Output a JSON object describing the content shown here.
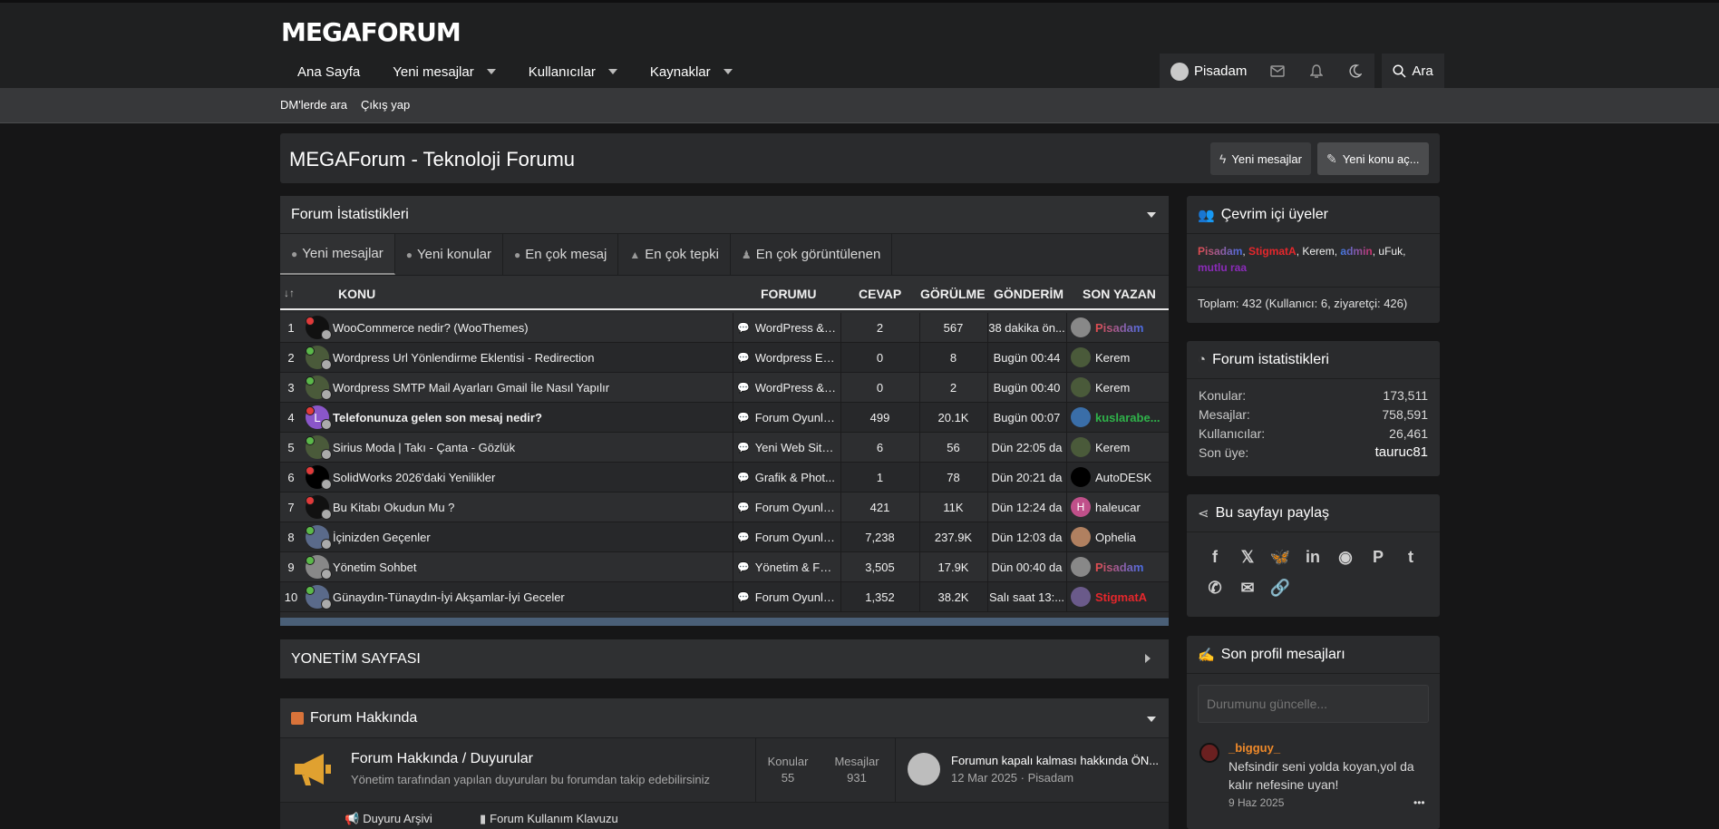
{
  "logo": "MEGAFORUM",
  "nav": [
    {
      "label": "Ana Sayfa",
      "caret": false
    },
    {
      "label": "Yeni mesajlar",
      "caret": true
    },
    {
      "label": "Kullanıcılar",
      "caret": true
    },
    {
      "label": "Kaynaklar",
      "caret": true
    }
  ],
  "user": {
    "name": "Pisadam",
    "search": "Ara"
  },
  "subnav": {
    "dm": "DM'lerde ara",
    "logout": "Çıkış yap"
  },
  "page_title": "MEGAForum - Teknoloji Forumu",
  "title_buttons": {
    "new_posts": "Yeni mesajlar",
    "new_thread": "Yeni konu aç..."
  },
  "stats": {
    "title": "Forum İstatistikleri",
    "tabs": [
      "Yeni mesajlar",
      "Yeni konular",
      "En çok mesaj",
      "En çok tepki",
      "En çok görüntülenen"
    ],
    "headers": {
      "sort": "↓↑",
      "konu": "KONU",
      "forum": "FORUMU",
      "cevap": "CEVAP",
      "gor": "GÖRÜLME",
      "gon": "GÖNDERİM",
      "son": "SON YAZAN"
    },
    "rows": [
      {
        "n": "1",
        "title": "WooCommerce nedir? (WooThemes)",
        "bold": false,
        "forum": "WordPress & ...",
        "cevap": "2",
        "gor": "567",
        "gon": "38 dakika ön...",
        "son": "Pisadam",
        "son_color": "pisadam",
        "dot": "#e03a3a",
        "av": "#111",
        "av_letter": "",
        "son_av": "#888",
        "son_letter": ""
      },
      {
        "n": "2",
        "title": "Wordpress Url Yönlendirme Eklentisi - Redirection",
        "bold": false,
        "forum": "Wordpress Ekl...",
        "cevap": "0",
        "gor": "8",
        "gon": "Bugün 00:44",
        "son": "Kerem",
        "son_color": "#f0f0f0",
        "dot": "#5bb84a",
        "av": "#4a5a3a",
        "av_letter": "",
        "son_av": "#4a5a3a",
        "son_letter": ""
      },
      {
        "n": "3",
        "title": "Wordpress SMTP Mail Ayarları Gmail İle Nasıl Yapılır",
        "bold": false,
        "forum": "WordPress & ...",
        "cevap": "0",
        "gor": "2",
        "gon": "Bugün 00:40",
        "son": "Kerem",
        "son_color": "#f0f0f0",
        "dot": "#5bb84a",
        "av": "#4a5a3a",
        "av_letter": "",
        "son_av": "#4a5a3a",
        "son_letter": ""
      },
      {
        "n": "4",
        "title": "Telefonunuza gelen son mesaj nedir?",
        "bold": true,
        "forum": "Forum Oyunları",
        "cevap": "499",
        "gor": "20.1K",
        "gon": "Bugün 00:07",
        "son": "kuslarabe...",
        "son_color": "#2fb24a",
        "dot": "#e03a3a",
        "av": "#8a56c9",
        "av_letter": "L",
        "son_av": "#3a6ea8",
        "son_letter": ""
      },
      {
        "n": "5",
        "title": "Sirius Moda | Takı - Çanta - Gözlük",
        "bold": false,
        "forum": "Yeni Web Sitel...",
        "cevap": "6",
        "gor": "56",
        "gon": "Dün 22:05 da",
        "son": "Kerem",
        "son_color": "#f0f0f0",
        "dot": "#5bb84a",
        "av": "#4a5a3a",
        "av_letter": "",
        "son_av": "#4a5a3a",
        "son_letter": ""
      },
      {
        "n": "6",
        "title": "SolidWorks 2026'daki Yenilikler",
        "bold": false,
        "forum": "Grafik & Phot...",
        "cevap": "1",
        "gor": "78",
        "gon": "Dün 20:21 da",
        "son": "AutoDESK",
        "son_color": "#f0f0f0",
        "dot": "#e03a3a",
        "av": "#000",
        "av_letter": "",
        "son_av": "#000",
        "son_letter": ""
      },
      {
        "n": "7",
        "title": "Bu Kitabı Okudun Mu ?",
        "bold": false,
        "forum": "Forum Oyunları",
        "cevap": "421",
        "gor": "11K",
        "gon": "Dün 12:24 da",
        "son": "haleucar",
        "son_color": "#f0f0f0",
        "dot": "#e03a3a",
        "av": "#111",
        "av_letter": "",
        "son_av": "#c0508a",
        "son_letter": "H"
      },
      {
        "n": "8",
        "title": "İçinizden Geçenler",
        "bold": false,
        "forum": "Forum Oyunları",
        "cevap": "7,238",
        "gor": "237.9K",
        "gon": "Dün 12:03 da",
        "son": "Ophelia",
        "son_color": "#f0f0f0",
        "dot": "#5bb84a",
        "av": "#5a6a8a",
        "av_letter": "",
        "son_av": "#b08060",
        "son_letter": ""
      },
      {
        "n": "9",
        "title": "Yönetim Sohbet",
        "bold": false,
        "forum": "Yönetim & For...",
        "cevap": "3,505",
        "gor": "17.9K",
        "gon": "Dün 00:40 da",
        "son": "Pisadam",
        "son_color": "pisadam",
        "dot": "#5bb84a",
        "av": "#888",
        "av_letter": "",
        "son_av": "#888",
        "son_letter": ""
      },
      {
        "n": "10",
        "title": "Günaydın-Tünaydın-İyi Akşamlar-İyi Geceler",
        "bold": false,
        "forum": "Forum Oyunları",
        "cevap": "1,352",
        "gor": "38.2K",
        "gon": "Salı saat 13:...",
        "son": "StigmatA",
        "son_color": "#e5272c",
        "dot": "#5bb84a",
        "av": "#5a6a8a",
        "av_letter": "",
        "son_av": "#6a5a8a",
        "son_letter": ""
      }
    ]
  },
  "yonetim": {
    "title": "YONETİM SAYFASI"
  },
  "forum_hakkinda": {
    "title": "Forum Hakkında",
    "node_title": "Forum Hakkında / Duyurular",
    "node_desc": "Yönetim tarafından yapılan duyuruları bu forumdan takip edebilirsiniz",
    "konular_label": "Konular",
    "konular": "55",
    "mesajlar_label": "Mesajlar",
    "mesajlar": "931",
    "last_title": "Forumun kapalı kalması hakkında ÖN...",
    "last_date": "12 Mar 2025",
    "last_user": "Pisadam",
    "sub1": "Duyuru Arşivi",
    "sub2": "Forum Kullanım Klavuzu"
  },
  "online": {
    "title": "Çevrim içi üyeler",
    "users": [
      {
        "name": "Pisadam",
        "color": "pisadam"
      },
      {
        "name": "StigmatA",
        "color": "#e5272c"
      },
      {
        "name": "Kerem",
        "color": "#f0f0f0"
      },
      {
        "name": "admin",
        "color": "admin"
      },
      {
        "name": "uFuk",
        "color": "#f0f0f0"
      },
      {
        "name": "mutlu raa",
        "color": "#8a2bb8"
      }
    ],
    "total": "Toplam: 432 (Kullanıcı: 6, ziyaretçi: 426)"
  },
  "forum_stats": {
    "title": "Forum istatistikleri",
    "items": [
      {
        "label": "Konular:",
        "value": "173,511"
      },
      {
        "label": "Mesajlar:",
        "value": "758,591"
      },
      {
        "label": "Kullanıcılar:",
        "value": "26,461"
      },
      {
        "label": "Son üye:",
        "value": "tauruc81"
      }
    ]
  },
  "share": {
    "title": "Bu sayfayı paylaş",
    "icons": [
      "facebook-icon",
      "x-icon",
      "bluesky-icon",
      "linkedin-icon",
      "reddit-icon",
      "pinterest-icon",
      "tumblr-icon",
      "whatsapp-icon",
      "email-icon",
      "link-icon"
    ]
  },
  "profile_posts": {
    "title": "Son profil mesajları",
    "placeholder": "Durumunu güncelle...",
    "user": "_bigguy_",
    "message": "Nefsindir seni yolda koyan,yol da kalır nefesine uyan!",
    "date": "9 Haz 2025",
    "more": "•••"
  }
}
